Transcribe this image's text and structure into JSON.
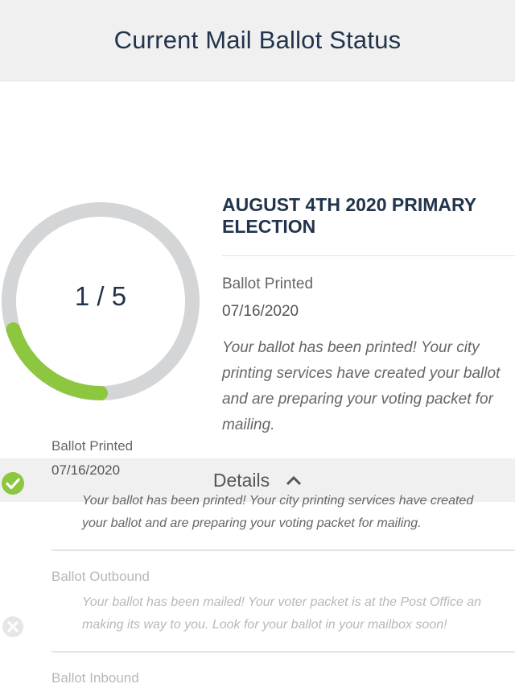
{
  "header": {
    "title": "Current Mail Ballot Status"
  },
  "progress": {
    "current": 1,
    "total": 5,
    "label": "1 / 5",
    "fraction": 0.2,
    "track_color": "#d4d5d6",
    "fill_color": "#8dc63f"
  },
  "election": {
    "title": "AUGUST 4TH 2020 PRIMARY ELECTION",
    "stage": "Ballot Printed",
    "date": "07/16/2020",
    "description": "Your ballot has been printed! Your city printing services have created your ballot and are preparing your voting packet for mailing."
  },
  "details": {
    "label": "Details",
    "icon": "chevron-up-icon"
  },
  "steps": [
    {
      "name": "Ballot Printed",
      "date": "07/16/2020",
      "description_lines": [
        "Your ballot has been printed! Your city printing services have created",
        "your ballot and are preparing your voting packet for mailing."
      ],
      "status": "complete",
      "icon": "check-circle-icon",
      "color": "#8dc63f"
    },
    {
      "name": "Ballot Outbound",
      "date": "",
      "description_lines": [
        "Your ballot has been mailed! Your voter packet is at the Post Office an",
        "making its way to you. Look for your ballot in your mailbox soon!"
      ],
      "status": "pending",
      "icon": "x-circle-icon",
      "color": "#e0e0e0"
    },
    {
      "name": "Ballot Inbound",
      "status": "pending"
    }
  ]
}
